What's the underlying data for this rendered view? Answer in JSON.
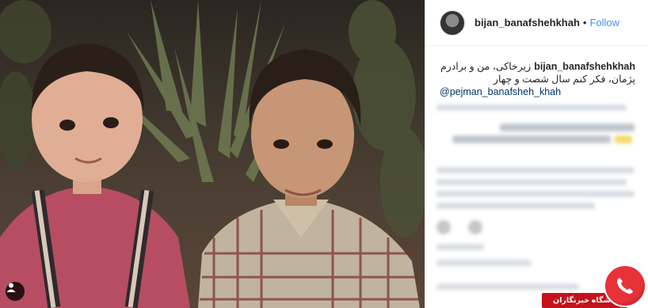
{
  "post": {
    "username": "bijan_banafshehkhah",
    "separator": "•",
    "follow_label": "Follow",
    "caption_user": "bijan_banafshehkhah",
    "caption_line1": "زیرخاکی، من و برادرم",
    "caption_line2": "پژمان، فکر کنم سال شصت و چهار",
    "caption_mention": "@pejman_banafsheh_khah"
  },
  "watermark": {
    "text": "باشگاه خبرنگاران",
    "logo_icon": "phone-handset-icon",
    "brand_color": "#c4121d"
  },
  "photo": {
    "tag_icon": "person-tag-icon"
  },
  "colors": {
    "follow": "#3897f0",
    "mention": "#003569",
    "text": "#262626"
  }
}
